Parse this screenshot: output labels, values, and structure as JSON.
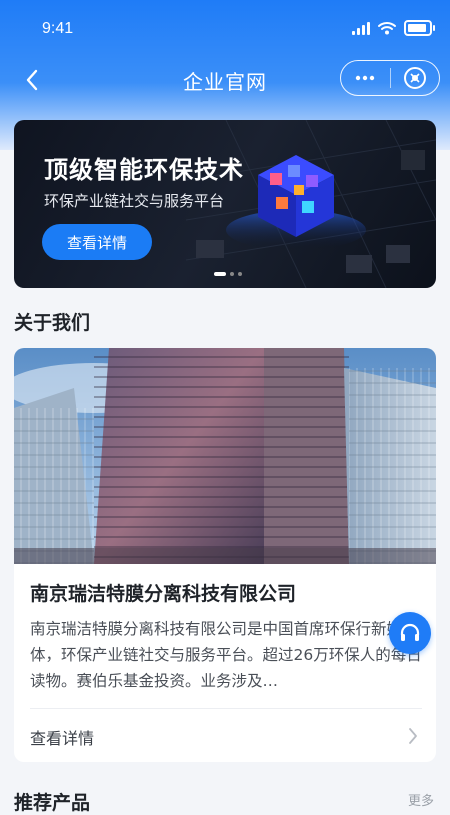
{
  "status_bar": {
    "time": "9:41"
  },
  "nav": {
    "title": "企业官网"
  },
  "banner": {
    "title": "顶级智能环保技术",
    "subtitle": "环保产业链社交与服务平台",
    "button_label": "查看详情"
  },
  "about": {
    "section_title": "关于我们",
    "company_name": "南京瑞洁特膜分离科技有限公司",
    "description": "南京瑞洁特膜分离科技有限公司是中国首席环保行新媒体，环保产业链社交与服务平台。超过26万环保人的每日读物。赛伯乐基金投资。业务涉及…",
    "detail_label": "查看详情"
  },
  "recommend": {
    "section_title": "推荐产品",
    "more_label": "更多"
  },
  "colors": {
    "primary": "#1f7cf7",
    "banner_bg": "#111827"
  },
  "icons": {
    "back": "chevron-left-icon",
    "more": "more-dots-icon",
    "close": "close-circle-icon",
    "arrow": "chevron-right-icon",
    "service": "headset-icon"
  }
}
